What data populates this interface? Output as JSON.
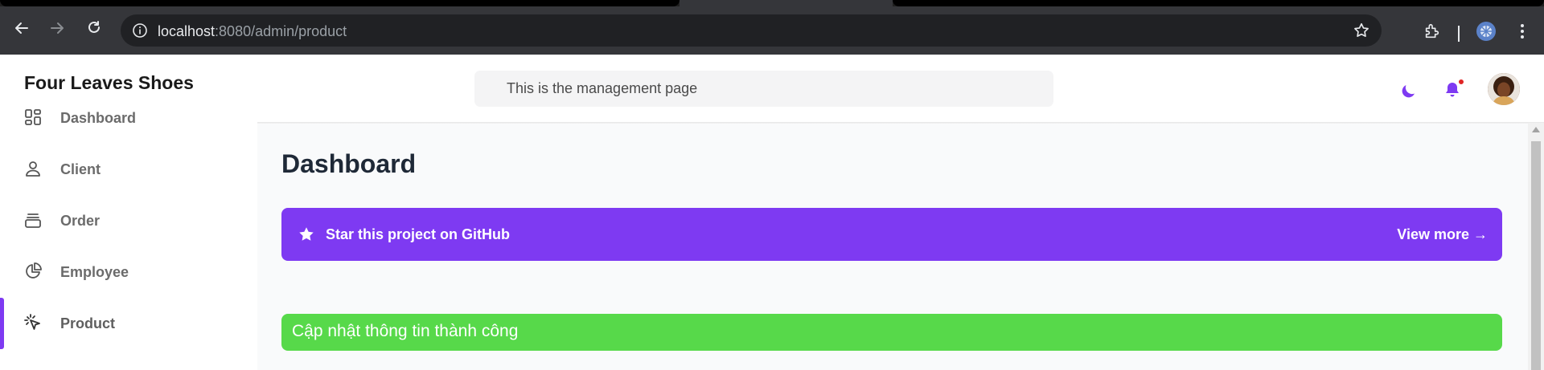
{
  "browser": {
    "url_host": "localhost",
    "url_path": ":8080/admin/product"
  },
  "app": {
    "brand": "Four Leaves Shoes",
    "search_text": "This is the management page"
  },
  "sidebar": {
    "items": [
      {
        "label": "Dashboard",
        "icon": "dashboard-icon"
      },
      {
        "label": "Client",
        "icon": "user-icon"
      },
      {
        "label": "Order",
        "icon": "inbox-stack-icon"
      },
      {
        "label": "Employee",
        "icon": "pie-chart-icon"
      },
      {
        "label": "Product",
        "icon": "cursor-click-icon",
        "active": true
      }
    ]
  },
  "main": {
    "title": "Dashboard",
    "banner_text": "Star this project on GitHub",
    "banner_link": "View more →",
    "alert_text": "Cập nhật thông tin thành công"
  },
  "colors": {
    "accent": "#7e3af2",
    "success": "#57d94a",
    "notification_dot": "#e02424"
  }
}
